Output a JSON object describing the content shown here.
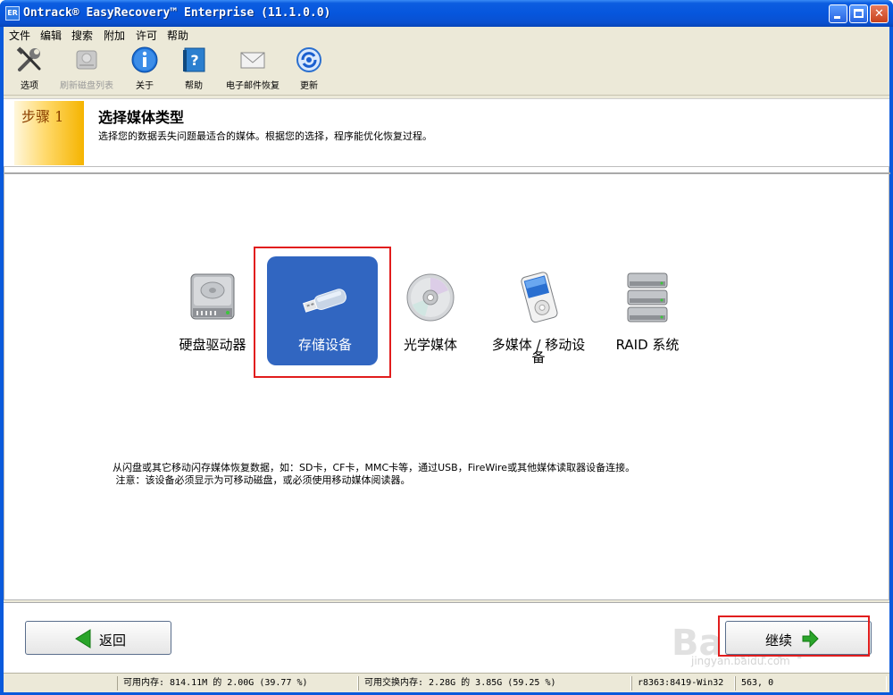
{
  "window": {
    "title": "Ontrack® EasyRecovery™ Enterprise (11.1.0.0)",
    "icon_text": "ER"
  },
  "menu": [
    "文件",
    "编辑",
    "搜索",
    "附加",
    "许可",
    "帮助"
  ],
  "toolbar": [
    {
      "label": "选项",
      "icon": "tools-icon",
      "enabled": true
    },
    {
      "label": "刷新磁盘列表",
      "icon": "disk-refresh-icon",
      "enabled": false
    },
    {
      "label": "关于",
      "icon": "info-icon",
      "enabled": true
    },
    {
      "label": "帮助",
      "icon": "help-book-icon",
      "enabled": true
    },
    {
      "label": "电子邮件恢复",
      "icon": "envelope-icon",
      "enabled": true
    },
    {
      "label": "更新",
      "icon": "update-icon",
      "enabled": true
    }
  ],
  "step": {
    "badge": "步骤 1",
    "title": "选择媒体类型",
    "description": "选择您的数据丢失问题最适合的媒体。根据您的选择，程序能优化恢复过程。"
  },
  "media_options": [
    {
      "label": "硬盘驱动器",
      "icon": "hard-drive-icon",
      "selected": false
    },
    {
      "label": "存储设备",
      "icon": "usb-flash-drive-icon",
      "selected": true
    },
    {
      "label": "光学媒体",
      "icon": "optical-disc-icon",
      "selected": false
    },
    {
      "label": "多媒体 / 移动设备",
      "icon": "media-player-icon",
      "selected": false
    },
    {
      "label": "RAID 系统",
      "icon": "raid-icon",
      "selected": false
    }
  ],
  "info": {
    "line1": "从闪盘或其它移动闪存媒体恢复数据，如：SD卡，CF卡，MMC卡等，通过USB，FireWire或其他媒体读取器设备连接。",
    "line2": " 注意：该设备必须显示为可移动磁盘，或必须使用移动媒体阅读器。"
  },
  "nav": {
    "back_label": "返回",
    "next_label": "继续"
  },
  "watermark": {
    "brand": "Bai百科",
    "url": "jingyan.baidu.com"
  },
  "status": {
    "memory": "可用内存: 814.11M 的 2.00G (39.77 %)",
    "swap": "可用交换内存: 2.28G 的 3.85G (59.25 %)",
    "build": "r8363:8419-Win32",
    "coords": "563, 0"
  },
  "colors": {
    "selection": "#3166c1",
    "highlight_outline": "#e11d1d",
    "title_bar": "#0656dd"
  }
}
